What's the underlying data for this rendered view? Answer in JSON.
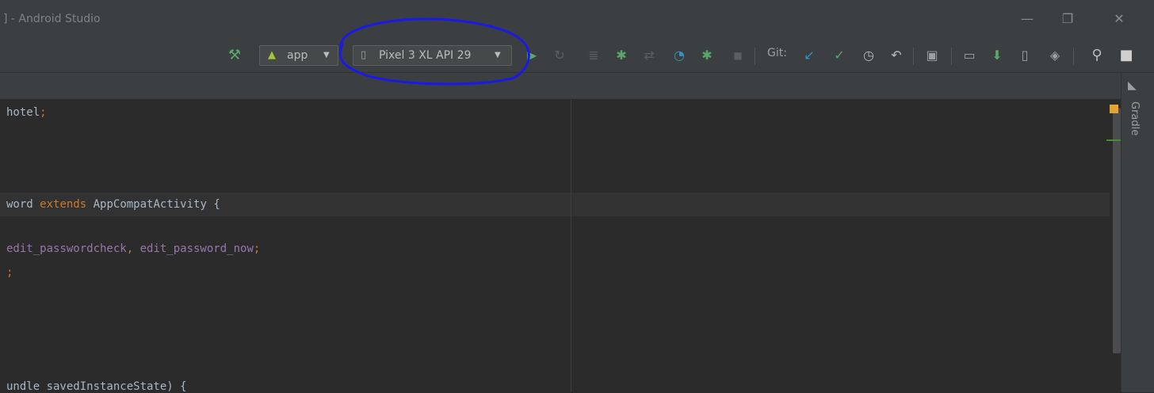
{
  "window": {
    "title": "] - Android Studio",
    "minimize_glyph": "—",
    "restore_glyph": "❐",
    "close_glyph": "✕"
  },
  "toolbar": {
    "build_glyph": "⚒",
    "module_combo_label": "app",
    "module_arrow": "▼",
    "device_combo_label": "Pixel 3 XL API 29",
    "device_arrow": "▼",
    "run_glyph": "▶",
    "apply_changes_glyph": "↻",
    "apply_code_glyph": "≣",
    "debug_glyph": "✱",
    "attach_glyph": "⇄",
    "profile_glyph": "◔",
    "attach_debugger_glyph": "✱",
    "stop_glyph": "■",
    "git_label": "Git:",
    "git_update_glyph": "↙",
    "git_commit_glyph": "✓",
    "git_history_glyph": "◷",
    "git_rollback_glyph": "↶",
    "project_structure_glyph": "▣",
    "device_file_glyph": "▭",
    "sdk_manager_glyph": "⬇",
    "avd_glyph": "▯",
    "layout_inspector_glyph": "◈",
    "search_glyph": "⚲",
    "account_glyph": "■"
  },
  "side_panel": {
    "gradle_label": "Gradle"
  },
  "editor": {
    "lines": [
      {
        "text": "hotel",
        "suffix": ";"
      },
      {
        "prefix": "word ",
        "keyword": "extends",
        "rest": " AppCompatActivity {"
      },
      {
        "field1": "edit_passwordcheck",
        "sep": ", ",
        "field2": "edit_password_now",
        "end": ";"
      },
      {
        "end": ";"
      },
      {
        "text": "undle savedInstanceState) {"
      }
    ]
  },
  "colors": {
    "editor_bg": "#2b2b2b",
    "toolbar_bg": "#3c3f41",
    "run_green": "#59a869",
    "bug_green": "#59a869",
    "git_blue": "#3592c4",
    "annotation_blue": "#1a1ae6"
  }
}
